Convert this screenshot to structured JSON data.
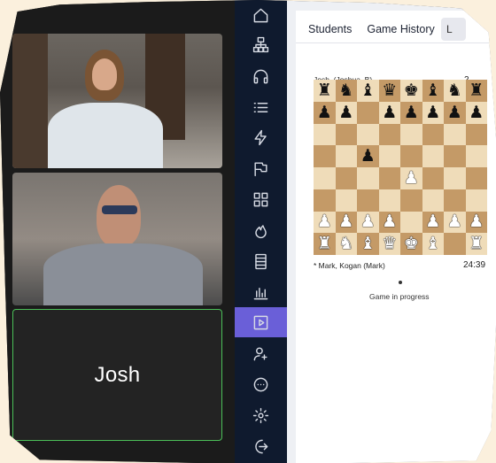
{
  "participants": [
    {
      "name": ""
    },
    {
      "name": ""
    },
    {
      "name": "Josh"
    }
  ],
  "nav_rail": {
    "items": [
      {
        "icon": "home-icon"
      },
      {
        "icon": "org-chart-icon"
      },
      {
        "icon": "headphones-icon"
      },
      {
        "icon": "list-icon"
      },
      {
        "icon": "lightning-icon"
      },
      {
        "icon": "flags-icon"
      },
      {
        "icon": "grid-icon"
      },
      {
        "icon": "flame-icon"
      },
      {
        "icon": "database-icon"
      },
      {
        "icon": "bar-chart-icon"
      },
      {
        "icon": "play-icon",
        "active": true
      },
      {
        "icon": "user-search-icon"
      },
      {
        "icon": "chat-icon"
      },
      {
        "icon": "gear-icon"
      },
      {
        "icon": "logout-icon"
      }
    ],
    "active_color": "#6a5fd8",
    "background": "#0f1a2e"
  },
  "panel": {
    "tabs": [
      "Students",
      "Game History"
    ],
    "tab_partial": "L",
    "game": {
      "top_player": "Josh, (Joshua_B)",
      "top_clock": "2",
      "bottom_player": "* Mark, Kogan (Mark)",
      "bottom_clock": "24:39",
      "status": "Game in progress",
      "board_rows": [
        "rnbqkbnr",
        "pp.ppppp",
        "........",
        "..p.....",
        "....P...",
        "........",
        "PPPP.PPP",
        "RNBQKB.R"
      ]
    }
  },
  "colors": {
    "video_active_border": "#4bbf58",
    "board_light": "#efdcb9",
    "board_dark": "#c49a67"
  }
}
